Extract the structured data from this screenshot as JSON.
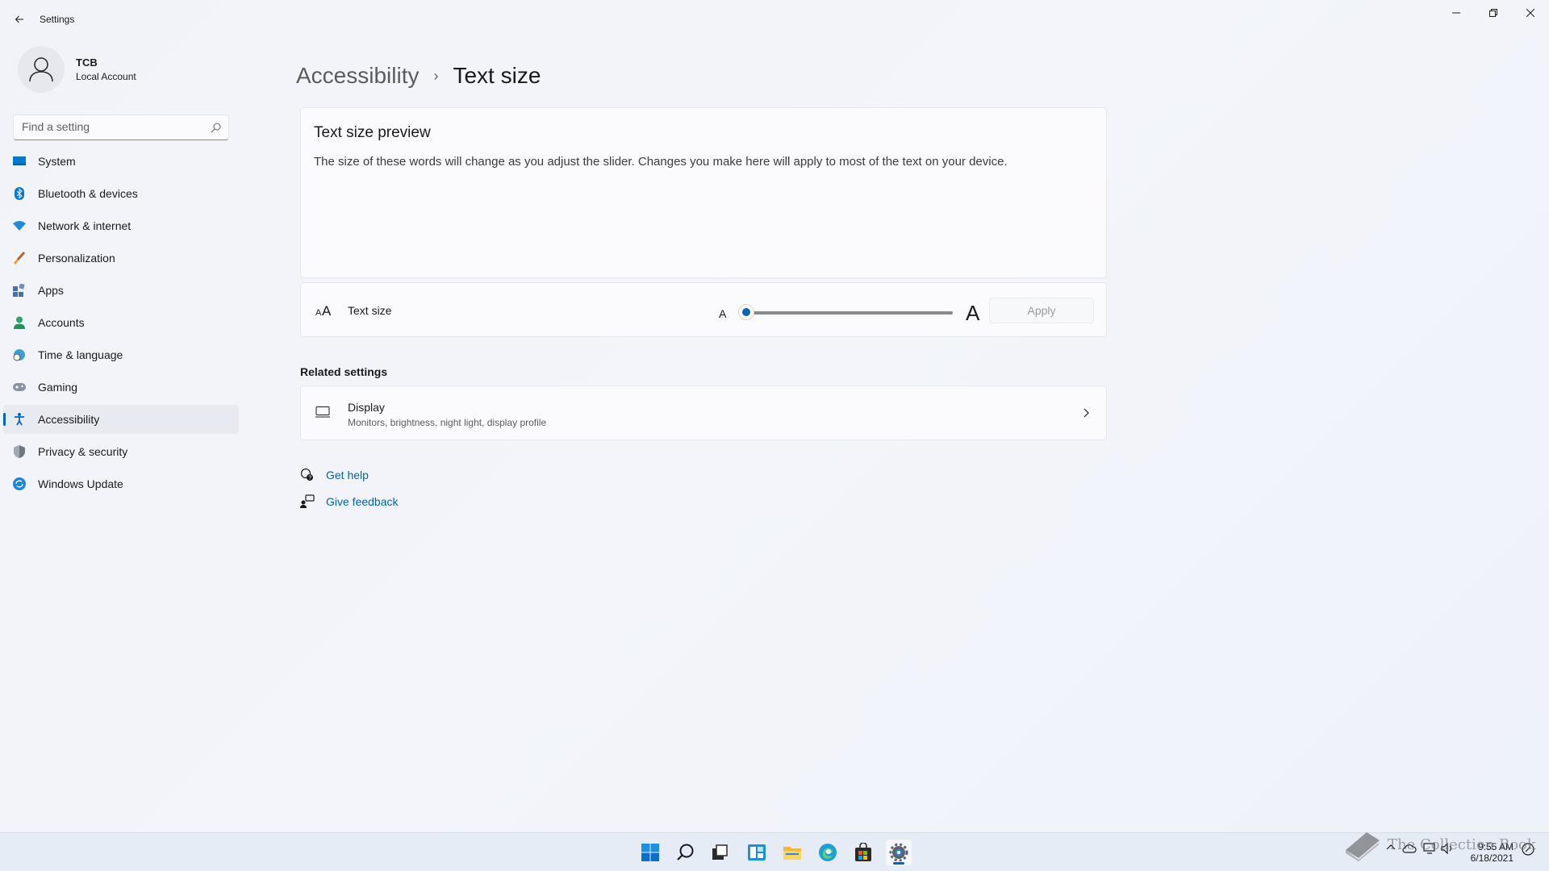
{
  "window": {
    "app_title": "Settings"
  },
  "profile": {
    "name": "TCB",
    "account_type": "Local Account"
  },
  "search": {
    "placeholder": "Find a setting"
  },
  "sidebar": {
    "items": [
      {
        "label": "System",
        "icon": "system-icon"
      },
      {
        "label": "Bluetooth & devices",
        "icon": "bluetooth-icon"
      },
      {
        "label": "Network & internet",
        "icon": "wifi-icon"
      },
      {
        "label": "Personalization",
        "icon": "brush-icon"
      },
      {
        "label": "Apps",
        "icon": "apps-icon"
      },
      {
        "label": "Accounts",
        "icon": "person-icon"
      },
      {
        "label": "Time & language",
        "icon": "globe-clock-icon"
      },
      {
        "label": "Gaming",
        "icon": "gamepad-icon"
      },
      {
        "label": "Accessibility",
        "icon": "accessibility-icon",
        "active": true
      },
      {
        "label": "Privacy & security",
        "icon": "shield-icon"
      },
      {
        "label": "Windows Update",
        "icon": "update-icon"
      }
    ]
  },
  "breadcrumb": {
    "parent": "Accessibility",
    "separator": "›",
    "current": "Text size"
  },
  "preview": {
    "title": "Text size preview",
    "text": "The size of these words will change as you adjust the slider. Changes you make here will apply to most of the text on your device."
  },
  "text_size": {
    "label": "Text size",
    "small_glyph": "A",
    "large_glyph": "A",
    "slider_value_fraction": 0.0,
    "apply_label": "Apply"
  },
  "related": {
    "title": "Related settings",
    "display": {
      "label": "Display",
      "description": "Monitors, brightness, night light, display profile"
    }
  },
  "help": {
    "get_help": "Get help",
    "give_feedback": "Give feedback"
  },
  "taskbar": {
    "apps": [
      "start-icon",
      "search-icon",
      "task-view-icon",
      "widgets-icon",
      "file-explorer-icon",
      "edge-icon",
      "store-icon",
      "settings-icon"
    ],
    "clock_time": "9:55 AM",
    "clock_date": "6/18/2021"
  },
  "watermark": {
    "text": "The Collection Book"
  },
  "colors": {
    "accent": "#0067c0",
    "link": "#0063b1",
    "background": "#f1f3f9"
  }
}
